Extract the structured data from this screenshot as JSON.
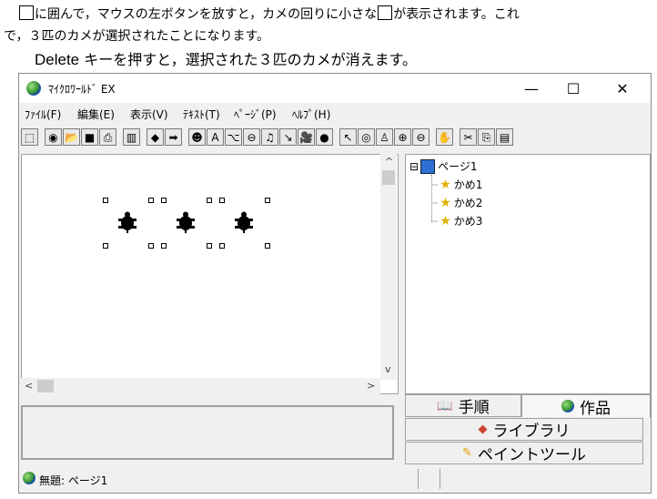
{
  "document": {
    "line1_before": "に囲んで，マウスの左ボタンを放すと，カメの回りに小さな",
    "line1_after": "が表示されます。これ",
    "line2": "で，３匹のカメが選択されたことになります。",
    "line3_key": "Delete",
    "line3_rest": " キーを押すと，選択された３匹のカメが消えます。"
  },
  "window": {
    "title": "ﾏｲｸﾛﾜｰﾙﾄﾞ EX",
    "controls": {
      "minimize": "—",
      "maximize": "☐",
      "close": "✕"
    }
  },
  "menu": [
    "ﾌｧｲﾙ(F)",
    "編集(E)",
    "表示(V)",
    "ﾃｷｽﾄ(T)",
    "ﾍﾟｰｼﾞ(P)",
    "ﾍﾙﾌﾟ(H)"
  ],
  "toolbar": {
    "icons": [
      "pointer-tool-icon",
      "world-icon",
      "open-folder-icon",
      "save-icon",
      "print-icon",
      "film-icon",
      "back-arrow-icon",
      "forward-arrow-icon",
      "character-icon",
      "text-box-icon",
      "paint-icon",
      "stamp-icon",
      "music-note-icon",
      "brush-icon",
      "video-camera-icon",
      "globe-icon",
      "arrow-cursor-icon",
      "eye-icon",
      "person-icon",
      "zoom-in-icon",
      "zoom-out-icon",
      "stop-hand-icon",
      "scissors-icon",
      "copy-icon",
      "paste-icon"
    ],
    "glyphs": [
      "⬚",
      "◉",
      "📂",
      "■",
      "⎙",
      "▥",
      "◆",
      "➡",
      "☻",
      "A",
      "⌥",
      "⊖",
      "♫",
      "↘",
      "🎥",
      "●",
      "↖",
      "◎",
      "♙",
      "⊕",
      "⊖",
      "✋",
      "✂",
      "⎘",
      "▤"
    ]
  },
  "tree": {
    "root": "ページ1",
    "items": [
      "かめ1",
      "かめ2",
      "かめ3"
    ],
    "expander": "⊟"
  },
  "tabs": {
    "procedure": "手順",
    "works": "作品",
    "library": "ライブラリ",
    "paint_tool": "ペイントツール",
    "active": "works"
  },
  "status": {
    "text": "無題: ページ1"
  },
  "scroll": {
    "up": "^",
    "down": "v",
    "left": "<",
    "right": ">"
  }
}
